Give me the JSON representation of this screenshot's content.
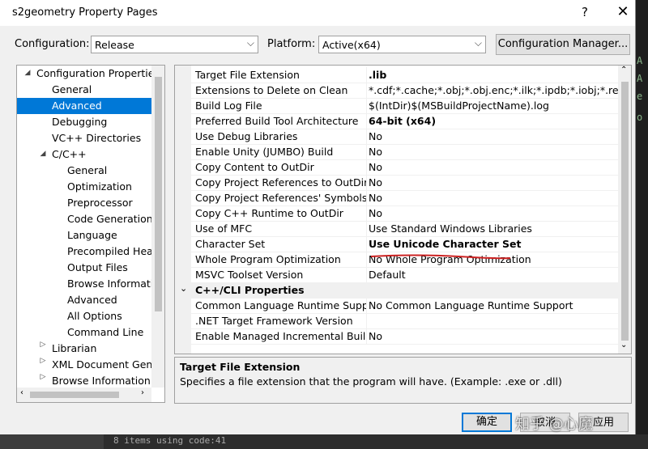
{
  "window": {
    "title": "s2geometry Property Pages",
    "help": "?",
    "close": "✕"
  },
  "config": {
    "configuration_label": "Configuration:",
    "configuration_value": "Release",
    "platform_label": "Platform:",
    "platform_value": "Active(x64)",
    "manager_button": "Configuration Manager..."
  },
  "tree": {
    "items": [
      {
        "label": "Configuration Properties"
      },
      {
        "label": "General"
      },
      {
        "label": "Advanced"
      },
      {
        "label": "Debugging"
      },
      {
        "label": "VC++ Directories"
      },
      {
        "label": "C/C++"
      },
      {
        "label": "General"
      },
      {
        "label": "Optimization"
      },
      {
        "label": "Preprocessor"
      },
      {
        "label": "Code Generation"
      },
      {
        "label": "Language"
      },
      {
        "label": "Precompiled Headers"
      },
      {
        "label": "Output Files"
      },
      {
        "label": "Browse Information"
      },
      {
        "label": "Advanced"
      },
      {
        "label": "All Options"
      },
      {
        "label": "Command Line"
      },
      {
        "label": "Librarian"
      },
      {
        "label": "XML Document Generator"
      },
      {
        "label": "Browse Information"
      }
    ],
    "selected": "Advanced"
  },
  "grid": {
    "rows": [
      {
        "name": "Target File Extension",
        "value": ".lib"
      },
      {
        "name": "Extensions to Delete on Clean",
        "value": "*.cdf;*.cache;*.obj;*.obj.enc;*.ilk;*.ipdb;*.iobj;*.resources"
      },
      {
        "name": "Build Log File",
        "value": "$(IntDir)$(MSBuildProjectName).log"
      },
      {
        "name": "Preferred Build Tool Architecture",
        "value": "64-bit (x64)"
      },
      {
        "name": "Use Debug Libraries",
        "value": "No"
      },
      {
        "name": "Enable Unity (JUMBO) Build",
        "value": "No"
      },
      {
        "name": "Copy Content to OutDir",
        "value": "No"
      },
      {
        "name": "Copy Project References to OutDir",
        "value": "No"
      },
      {
        "name": "Copy Project References' Symbols to OutDir",
        "value": "No"
      },
      {
        "name": "Copy C++ Runtime to OutDir",
        "value": "No"
      },
      {
        "name": "Use of MFC",
        "value": "Use Standard Windows Libraries"
      },
      {
        "name": "Character Set",
        "value": "Use Unicode Character Set"
      },
      {
        "name": "Whole Program Optimization",
        "value": "No Whole Program Optimization"
      },
      {
        "name": "MSVC Toolset Version",
        "value": "Default"
      }
    ],
    "section": "C++/CLI Properties",
    "cli_rows": [
      {
        "name": "Common Language Runtime Support",
        "value": "No Common Language Runtime Support"
      },
      {
        "name": ".NET Target Framework Version",
        "value": ""
      },
      {
        "name": "Enable Managed Incremental Build",
        "value": "No"
      }
    ]
  },
  "description": {
    "title": "Target File Extension",
    "text": "Specifies a file extension that the program will have. (Example: .exe or .dll)"
  },
  "buttons": {
    "ok": "确定",
    "cancel": "取消",
    "apply": "应用"
  },
  "watermark": "知乎 @心魔",
  "background": {
    "bottom_text": "8 items using code:41"
  },
  "colors": {
    "selection": "#0078d7",
    "annotation": "#cc2222"
  }
}
